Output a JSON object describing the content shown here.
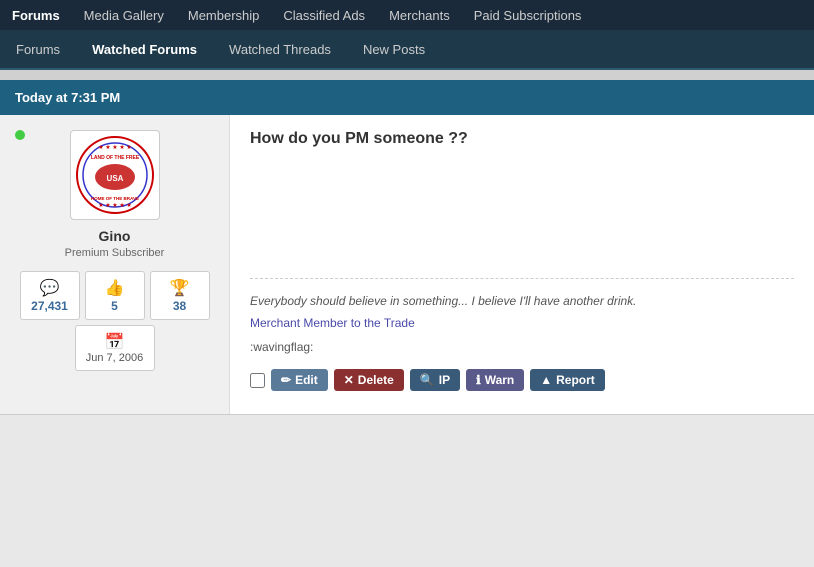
{
  "topNav": {
    "items": [
      {
        "label": "Forums",
        "active": true
      },
      {
        "label": "Media Gallery",
        "active": false
      },
      {
        "label": "Membership",
        "active": false
      },
      {
        "label": "Classified Ads",
        "active": false
      },
      {
        "label": "Merchants",
        "active": false
      },
      {
        "label": "Paid Subscriptions",
        "active": false
      }
    ]
  },
  "secondaryNav": {
    "items": [
      {
        "label": "Forums",
        "active": false
      },
      {
        "label": "Watched Forums",
        "active": true
      },
      {
        "label": "Watched Threads",
        "active": false
      },
      {
        "label": "New Posts",
        "active": false
      }
    ]
  },
  "dateHeader": {
    "text": "Today at 7:31 PM"
  },
  "post": {
    "title": "How do you PM someone ??",
    "body": "",
    "signature": "Everybody should believe in something... I believe I'll have another drink.",
    "merchant": "Merchant Member to the Trade",
    "emoticon": ":wavingflag:"
  },
  "user": {
    "name": "Gino",
    "role": "Premium Subscriber",
    "online": true,
    "stats": {
      "posts": {
        "value": "27,431",
        "icon": "💬"
      },
      "likes": {
        "value": "5",
        "icon": "👍"
      },
      "trophy": {
        "value": "38",
        "icon": "🏆"
      }
    },
    "joinDate": "Jun 7, 2006"
  },
  "actions": {
    "edit": "Edit",
    "delete": "Delete",
    "ip": "IP",
    "warn": "Warn",
    "report": "Report"
  }
}
